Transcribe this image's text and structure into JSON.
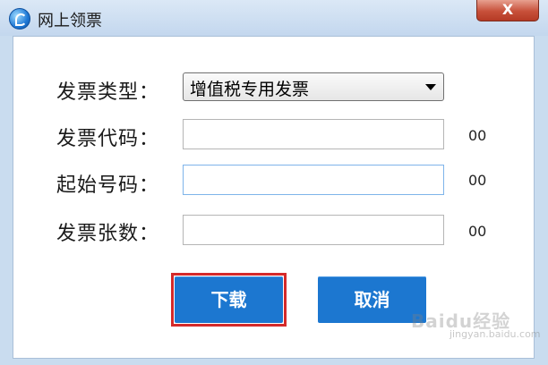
{
  "window": {
    "title": "网上领票",
    "close_label": "X"
  },
  "form": {
    "invoice_type": {
      "label": "发票类型：",
      "selected": "增值税专用发票"
    },
    "invoice_code": {
      "label": "发票代码：",
      "value": "",
      "suffix": "00"
    },
    "start_number": {
      "label": "起始号码：",
      "value": "",
      "suffix": "00"
    },
    "invoice_count": {
      "label": "发票张数：",
      "value": "",
      "suffix": "00"
    }
  },
  "buttons": {
    "download_label": "下载",
    "cancel_label": "取消"
  },
  "watermark": {
    "text": "Baidu经验",
    "sub": "jingyan.baidu.com"
  },
  "colors": {
    "button_blue": "#1c77d0",
    "highlight_red": "#d42a2a",
    "close_red": "#c7503a"
  }
}
